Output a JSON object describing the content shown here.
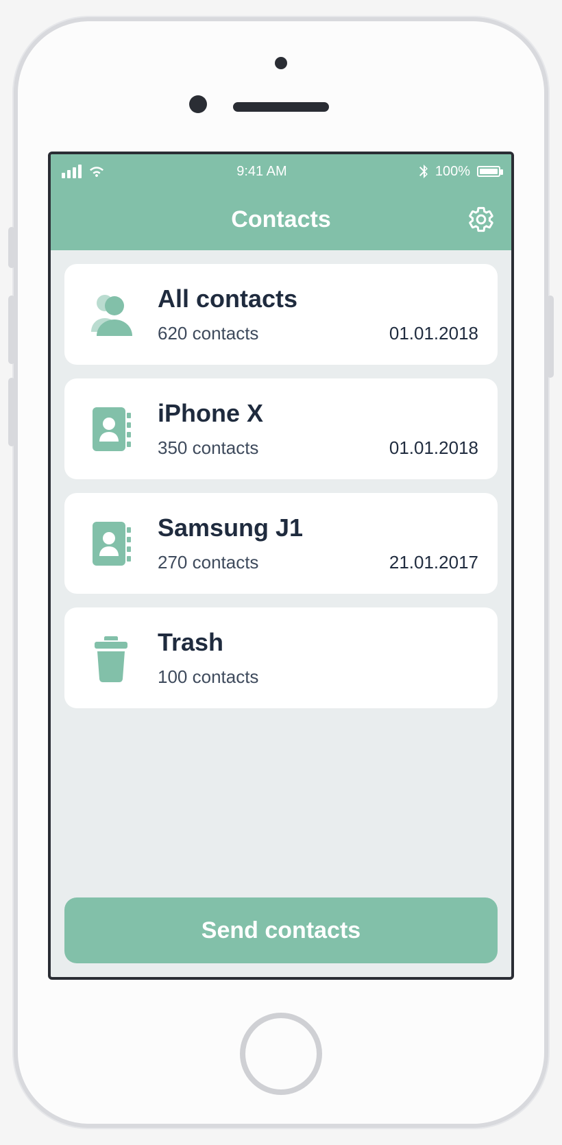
{
  "status": {
    "time": "9:41 AM",
    "battery": "100%"
  },
  "header": {
    "title": "Contacts"
  },
  "cards": [
    {
      "icon": "people",
      "title": "All contacts",
      "subtitle": "620 contacts",
      "date": "01.01.2018"
    },
    {
      "icon": "addressbook",
      "title": "iPhone X",
      "subtitle": "350 contacts",
      "date": "01.01.2018"
    },
    {
      "icon": "addressbook",
      "title": "Samsung J1",
      "subtitle": "270 contacts",
      "date": "21.01.2017"
    },
    {
      "icon": "trash",
      "title": "Trash",
      "subtitle": "100 contacts",
      "date": ""
    }
  ],
  "footer": {
    "send_label": "Send contacts"
  }
}
